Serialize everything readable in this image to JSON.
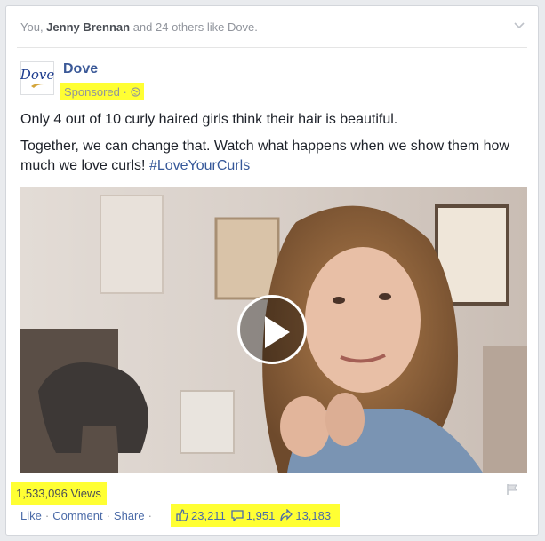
{
  "social": {
    "prefix": "You, ",
    "friend": "Jenny Brennan",
    "suffix": " and 24 others like Dove."
  },
  "page": {
    "logo_text": "Dove",
    "name": "Dove",
    "sponsored_label": "Sponsored ·"
  },
  "post": {
    "line1": "Only 4 out of 10 curly haired girls think their hair is beautiful.",
    "line2": "Together, we can change that. Watch what happens when we show them how much we love curls! ",
    "hashtag": "#LoveYourCurls"
  },
  "video": {
    "views": "1,533,096 Views"
  },
  "actions": {
    "like": "Like",
    "comment": "Comment",
    "share": "Share",
    "sep": "·"
  },
  "counts": {
    "likes": "23,211",
    "comments": "1,951",
    "shares": "13,183"
  },
  "icons": {
    "chevron": "chevron-down-icon",
    "globe": "globe-icon",
    "flag": "flag-icon",
    "thumbs": "thumbs-up-icon",
    "comment": "comment-bubble-icon",
    "share": "share-arrow-icon"
  },
  "colors": {
    "link": "#3b5998",
    "highlight": "#ffff33",
    "muted": "#90949c"
  }
}
